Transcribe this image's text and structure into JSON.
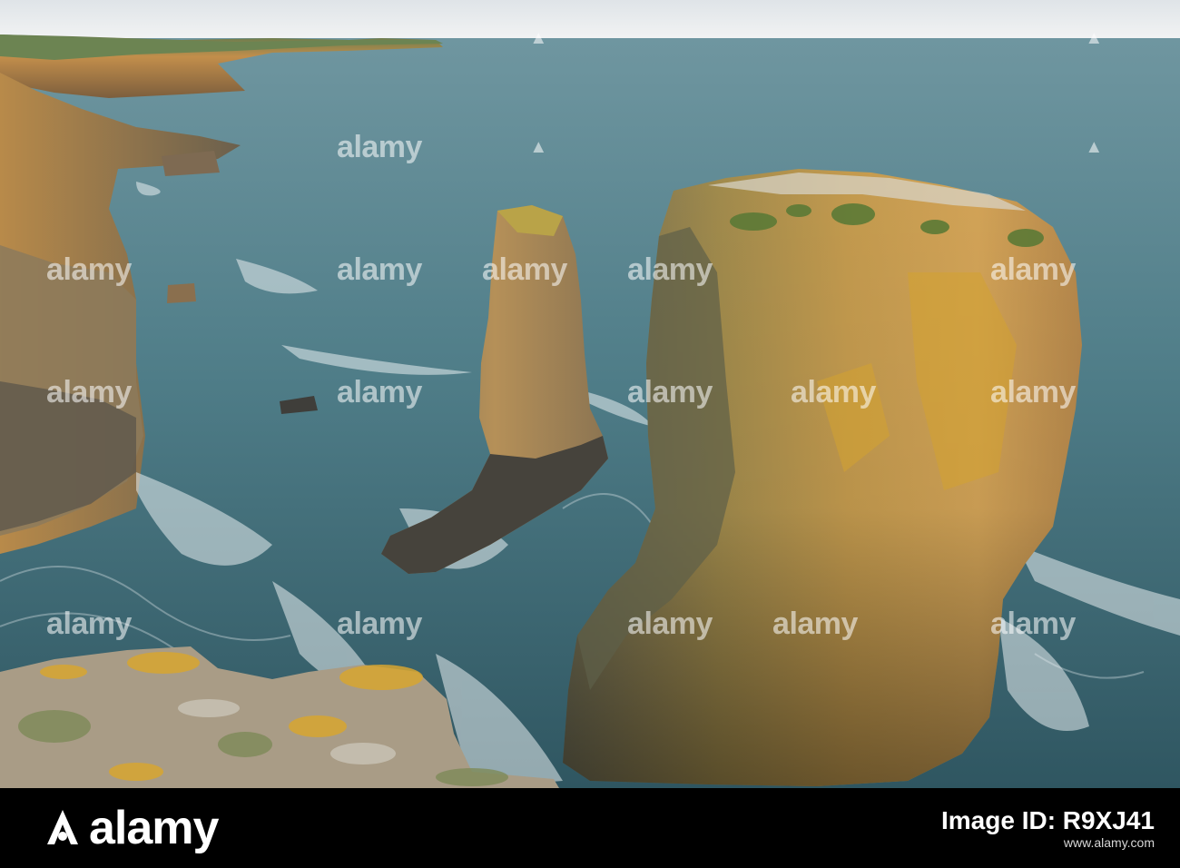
{
  "photo": {
    "subject": "coastal sea stacks at sunset",
    "colors": {
      "sky": "#e9ecee",
      "sea_far": "#5f8a96",
      "sea_near": "#3f6b76",
      "rock_lit": "#c79a4a",
      "rock_shadow": "#5a5347",
      "lichen": "#d2a52c",
      "foam": "#e8eef0"
    }
  },
  "watermark": {
    "text": "alamy",
    "tile_count": 20
  },
  "footer": {
    "brand": "alamy",
    "image_id_label": "Image ID: R9XJ41",
    "url": "www.alamy.com"
  }
}
